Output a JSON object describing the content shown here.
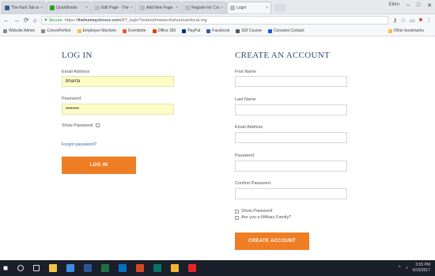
{
  "browser": {
    "tabs": [
      {
        "label": "The Hunt Tab on Im",
        "color": "#3b5998",
        "active": false
      },
      {
        "label": "QuickBooks",
        "color": "#2ca01c",
        "active": false
      },
      {
        "label": "Edit Page - The Hu",
        "color": "#bbbbbb",
        "active": false
      },
      {
        "label": "Add New Page",
        "color": "#bbbbbb",
        "active": false
      },
      {
        "label": "Register for Cour",
        "color": "#bbbbbb",
        "active": false
      },
      {
        "label": "Login",
        "color": "#bbbbbb",
        "active": true
      }
    ],
    "window_user": "Ellen",
    "window_controls": [
      "–",
      "□",
      "✕"
    ],
    "address": {
      "secure_label": "Secure",
      "url_prefix": "https://",
      "url_host": "thehuntsachovox.com",
      "url_path": "/HT_login?redirekt=www.thehuntcanfocal.org"
    },
    "bookmarks": [
      {
        "label": "Website Admin",
        "color": "#888888"
      },
      {
        "label": "ConvoPerfect",
        "color": "#888888"
      },
      {
        "label": "Employee Machine",
        "color": "#f0c14b"
      },
      {
        "label": "Eventbrite",
        "color": "#f05537"
      },
      {
        "label": "Office 365",
        "color": "#eb3c00"
      },
      {
        "label": "PayPal",
        "color": "#003087"
      },
      {
        "label": "Facebook",
        "color": "#3b5998"
      },
      {
        "label": "SDI Course",
        "color": "#555555"
      },
      {
        "label": "Constant Contact",
        "color": "#1856ed"
      }
    ],
    "other_bookmarks": "Other bookmarks"
  },
  "login": {
    "heading": "LOG IN",
    "email_label": "Email Address",
    "email_value": "bhanta",
    "password_label": "Password",
    "password_value": "••••••••",
    "show_password_label": "Show Password",
    "forgot_password": "Forgot password?",
    "button": "LOG IN"
  },
  "signup": {
    "heading": "CREATE AN ACCOUNT",
    "first_name_label": "First Name",
    "last_name_label": "Last Name",
    "email_label": "Email Address",
    "password_label": "Password",
    "confirm_password_label": "Confirm Password",
    "show_password_label": "Show Password",
    "military_label": "Are you a Military Family?",
    "button": "CREATE ACCOUNT"
  },
  "taskbar": {
    "apps": [
      {
        "name": "file-explorer-icon",
        "color": "#f3c447"
      },
      {
        "name": "store-icon",
        "color": "#3a8ee6"
      },
      {
        "name": "word-icon",
        "color": "#2b579a"
      },
      {
        "name": "excel-icon",
        "color": "#1f7244"
      },
      {
        "name": "outlook-icon",
        "color": "#0072c6"
      },
      {
        "name": "powerpoint-icon",
        "color": "#d24726"
      },
      {
        "name": "publisher-icon",
        "color": "#077568"
      },
      {
        "name": "chrome-icon",
        "color": "#f2b632"
      },
      {
        "name": "acrobat-icon",
        "color": "#e4252c"
      }
    ],
    "time": "3:55 PM",
    "date": "6/15/2017"
  }
}
